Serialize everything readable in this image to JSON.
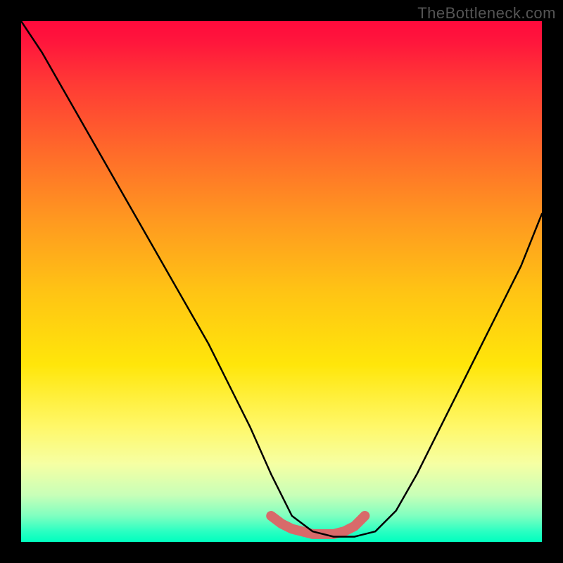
{
  "watermark": "TheBottleneck.com",
  "chart_data": {
    "type": "line",
    "title": "",
    "xlabel": "",
    "ylabel": "",
    "xlim": [
      0,
      100
    ],
    "ylim": [
      0,
      100
    ],
    "background_gradient": {
      "direction": "vertical",
      "stops": [
        {
          "pos": 0,
          "color": "#ff0a3c",
          "meaning": "high-bottleneck"
        },
        {
          "pos": 50,
          "color": "#ffc414",
          "meaning": "moderate"
        },
        {
          "pos": 100,
          "color": "#00ffbf",
          "meaning": "no-bottleneck"
        }
      ]
    },
    "series": [
      {
        "name": "bottleneck-curve",
        "x": [
          0,
          4,
          8,
          12,
          16,
          20,
          24,
          28,
          32,
          36,
          40,
          44,
          48,
          52,
          56,
          60,
          64,
          68,
          72,
          76,
          80,
          84,
          88,
          92,
          96,
          100
        ],
        "y": [
          100,
          94,
          87,
          80,
          73,
          66,
          59,
          52,
          45,
          38,
          30,
          22,
          13,
          5,
          2,
          1,
          1,
          2,
          6,
          13,
          21,
          29,
          37,
          45,
          53,
          63
        ]
      },
      {
        "name": "optimal-flat-region",
        "x": [
          48,
          50,
          52,
          54,
          56,
          58,
          60,
          62,
          64,
          66
        ],
        "y": [
          5,
          3.5,
          2.5,
          2,
          1.5,
          1.5,
          1.5,
          2,
          3,
          5
        ]
      }
    ],
    "annotations": []
  }
}
